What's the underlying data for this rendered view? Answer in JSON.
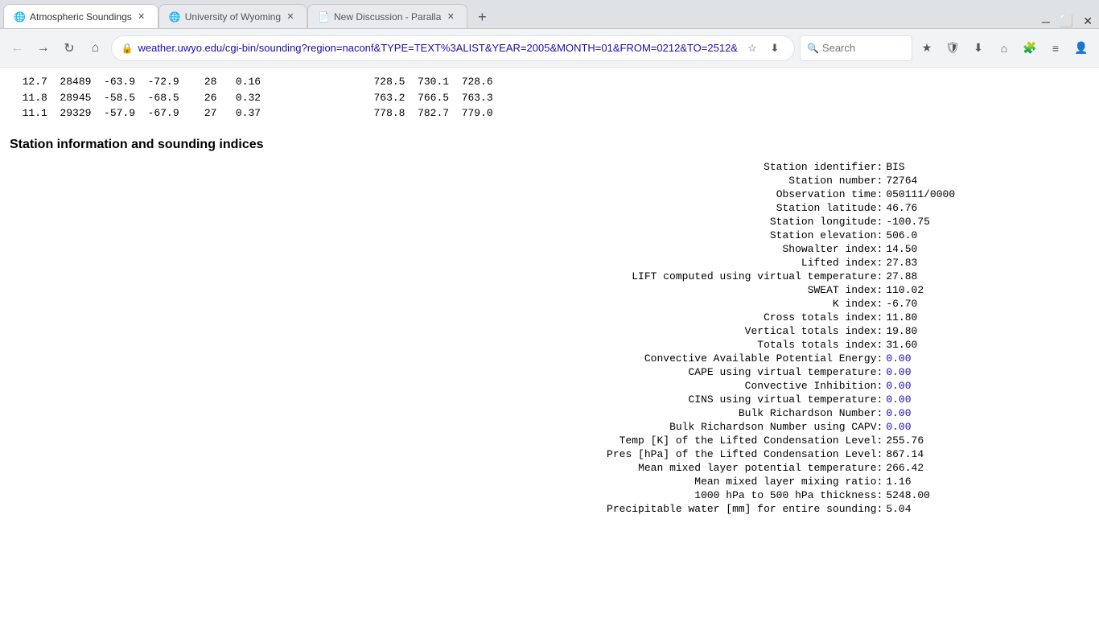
{
  "browser": {
    "tabs": [
      {
        "id": "tab1",
        "label": "Atmospheric Soundings",
        "active": true,
        "favicon": "🌐"
      },
      {
        "id": "tab2",
        "label": "University of Wyoming",
        "active": false,
        "favicon": "🌐"
      },
      {
        "id": "tab3",
        "label": "New Discussion - Paralla",
        "active": false,
        "favicon": "📄"
      }
    ],
    "url": "weather.uwyo.edu/cgi-bin/sounding?region=naconf&TYPE=TEXT%3ALIST&YEAR=2005&MONTH=01&FROM=0212&TO=2512&",
    "search_placeholder": "Search"
  },
  "top_data_lines": [
    "  12.7  28489  -63.9  -72.9    28   0.16                  728.5  730.1  728.6",
    "  11.8  28945  -58.5  -68.5    26   0.32                  763.2  766.5  763.3",
    "  11.1  29329  -57.9  -67.9    27   0.37                  778.8  782.7  779.0"
  ],
  "section_title": "Station information and sounding indices",
  "station_info": [
    {
      "label": "Station identifier:",
      "value": "BIS",
      "blue": false
    },
    {
      "label": "Station number:",
      "value": "72764",
      "blue": false
    },
    {
      "label": "Observation time:",
      "value": "050111/0000",
      "blue": false
    },
    {
      "label": "Station latitude:",
      "value": "46.76",
      "blue": false
    },
    {
      "label": "Station longitude:",
      "value": "-100.75",
      "blue": false
    },
    {
      "label": "Station elevation:",
      "value": "506.0",
      "blue": false
    },
    {
      "label": "Showalter index:",
      "value": "14.50",
      "blue": false
    },
    {
      "label": "Lifted index:",
      "value": "27.83",
      "blue": false
    },
    {
      "label": "LIFT computed using virtual temperature:",
      "value": "27.88",
      "blue": false
    },
    {
      "label": "SWEAT index:",
      "value": "110.02",
      "blue": false
    },
    {
      "label": "K index:",
      "value": "-6.70",
      "blue": false
    },
    {
      "label": "Cross totals index:",
      "value": "11.80",
      "blue": false
    },
    {
      "label": "Vertical totals index:",
      "value": "19.80",
      "blue": false
    },
    {
      "label": "Totals totals index:",
      "value": "31.60",
      "blue": false
    },
    {
      "label": "Convective Available Potential Energy:",
      "value": "0.00",
      "blue": true
    },
    {
      "label": "CAPE using virtual temperature:",
      "value": "0.00",
      "blue": true
    },
    {
      "label": "Convective Inhibition:",
      "value": "0.00",
      "blue": true
    },
    {
      "label": "CINS using virtual temperature:",
      "value": "0.00",
      "blue": true
    },
    {
      "label": "Bulk Richardson Number:",
      "value": "0.00",
      "blue": true
    },
    {
      "label": "Bulk Richardson Number using CAPV:",
      "value": "0.00",
      "blue": true
    },
    {
      "label": "Temp [K] of the Lifted Condensation Level:",
      "value": "255.76",
      "blue": false
    },
    {
      "label": "Pres [hPa] of the Lifted Condensation Level:",
      "value": "867.14",
      "blue": false
    },
    {
      "label": "Mean mixed layer potential temperature:",
      "value": "266.42",
      "blue": false
    },
    {
      "label": "Mean mixed layer mixing ratio:",
      "value": "1.16",
      "blue": false
    },
    {
      "label": "1000 hPa to 500 hPa thickness:",
      "value": "5248.00",
      "blue": false
    },
    {
      "label": "Precipitable water [mm] for entire sounding:",
      "value": "5.04",
      "blue": false
    }
  ]
}
